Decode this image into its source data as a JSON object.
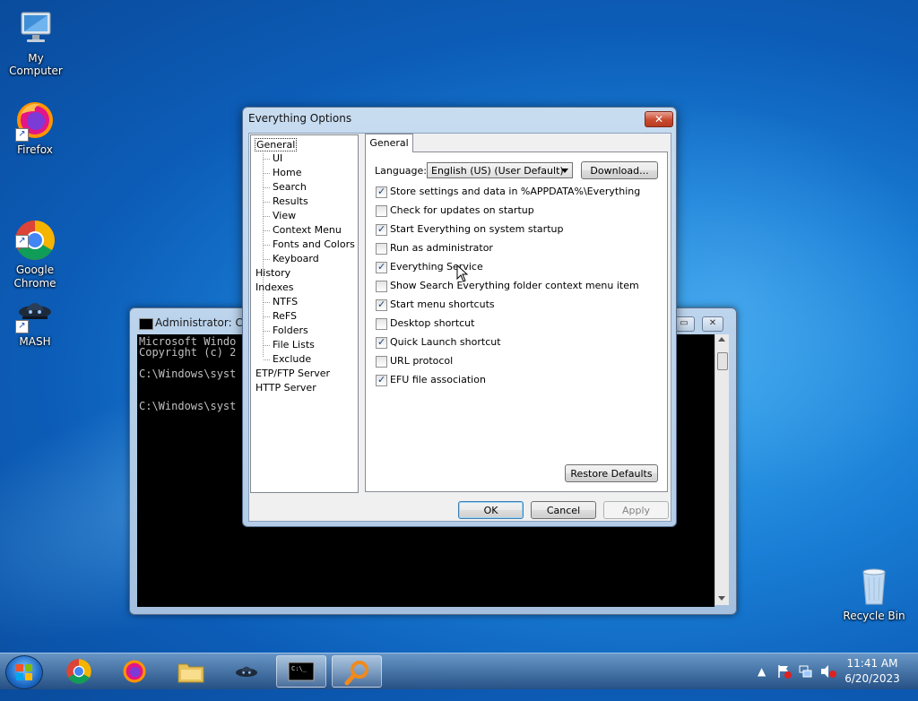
{
  "desktop": {
    "icons": [
      {
        "label": "My Computer"
      },
      {
        "label": "Firefox"
      },
      {
        "label": "Google\nChrome"
      },
      {
        "label": "MASH"
      },
      {
        "label": "Recycle Bin"
      }
    ]
  },
  "cmd": {
    "title": "Administrator: Co",
    "lines": "Microsoft Windo\nCopyright (c) 2\n\nC:\\Windows\\syst\n\n\nC:\\Windows\\syst"
  },
  "dialog": {
    "title": "Everything Options",
    "close_label": "✕",
    "tree": {
      "general": "General",
      "ui": "UI",
      "home": "Home",
      "search": "Search",
      "results": "Results",
      "view": "View",
      "context_menu": "Context Menu",
      "fonts_colors": "Fonts and Colors",
      "keyboard": "Keyboard",
      "history": "History",
      "indexes": "Indexes",
      "ntfs": "NTFS",
      "refs": "ReFS",
      "folders": "Folders",
      "file_lists": "File Lists",
      "exclude": "Exclude",
      "etp_ftp": "ETP/FTP Server",
      "http": "HTTP Server"
    },
    "tab_label": "General",
    "language_label": "Language:",
    "language_value": "English (US) (User Default)",
    "download_label": "Download...",
    "checkboxes": [
      {
        "label": "Store settings and data in %APPDATA%\\Everything",
        "checked": true
      },
      {
        "label": "Check for updates on startup",
        "checked": false
      },
      {
        "label": "Start Everything on system startup",
        "checked": true
      },
      {
        "label": "Run as administrator",
        "checked": false
      },
      {
        "label": "Everything Service",
        "checked": true
      },
      {
        "label": "Show Search Everything folder context menu item",
        "checked": false
      },
      {
        "label": "Start menu shortcuts",
        "checked": true
      },
      {
        "label": "Desktop shortcut",
        "checked": false
      },
      {
        "label": "Quick Launch shortcut",
        "checked": true
      },
      {
        "label": "URL protocol",
        "checked": false
      },
      {
        "label": "EFU file association",
        "checked": true
      }
    ],
    "restore_defaults_label": "Restore Defaults",
    "ok_label": "OK",
    "cancel_label": "Cancel",
    "apply_label": "Apply"
  },
  "taskbar": {
    "time": "11:41 AM",
    "date": "6/20/2023"
  }
}
